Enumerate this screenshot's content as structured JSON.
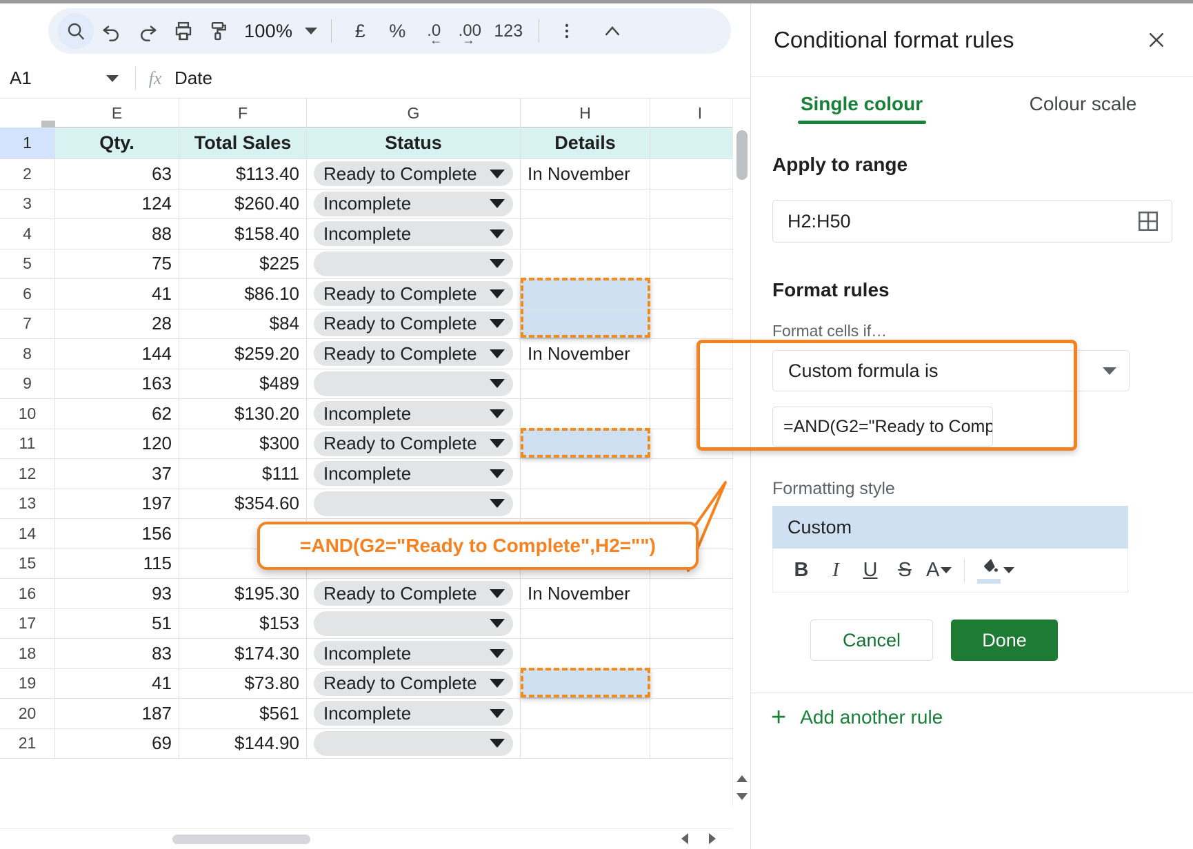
{
  "toolbar": {
    "icons": [
      "search-icon",
      "undo-icon",
      "redo-icon",
      "print-icon",
      "paint-format-icon"
    ],
    "zoom_value": "100%",
    "currency_label": "£",
    "percent_label": "%",
    "decrease_decimal_label": ".0",
    "increase_decimal_label": ".00",
    "more_formats_label": "123",
    "more_icon": "three-dots-vertical-icon",
    "collapse_icon": "chevron-up-icon"
  },
  "formula_bar": {
    "name_box_value": "A1",
    "fx_label": "fx",
    "cell_value": "Date"
  },
  "grid": {
    "columns": [
      "E",
      "F",
      "G",
      "H",
      "I"
    ],
    "header_row": {
      "number": "1",
      "cells": [
        "Qty.",
        "Total Sales",
        "Status",
        "Details",
        ""
      ]
    },
    "rows": [
      {
        "n": "2",
        "qty": "63",
        "sales": "$113.40",
        "status": "Ready to Complete",
        "details": "In November",
        "highlight": false
      },
      {
        "n": "3",
        "qty": "124",
        "sales": "$260.40",
        "status": "Incomplete",
        "details": "",
        "highlight": false
      },
      {
        "n": "4",
        "qty": "88",
        "sales": "$158.40",
        "status": "Incomplete",
        "details": "",
        "highlight": false
      },
      {
        "n": "5",
        "qty": "75",
        "sales": "$225",
        "status": "",
        "details": "",
        "highlight": false
      },
      {
        "n": "6",
        "qty": "41",
        "sales": "$86.10",
        "status": "Ready to Complete",
        "details": "",
        "highlight": true
      },
      {
        "n": "7",
        "qty": "28",
        "sales": "$84",
        "status": "Ready to Complete",
        "details": "",
        "highlight": true
      },
      {
        "n": "8",
        "qty": "144",
        "sales": "$259.20",
        "status": "Ready to Complete",
        "details": "In November",
        "highlight": false
      },
      {
        "n": "9",
        "qty": "163",
        "sales": "$489",
        "status": "",
        "details": "",
        "highlight": false
      },
      {
        "n": "10",
        "qty": "62",
        "sales": "$130.20",
        "status": "Incomplete",
        "details": "",
        "highlight": false
      },
      {
        "n": "11",
        "qty": "120",
        "sales": "$300",
        "status": "Ready to Complete",
        "details": "",
        "highlight": true
      },
      {
        "n": "12",
        "qty": "37",
        "sales": "$111",
        "status": "Incomplete",
        "details": "",
        "highlight": false
      },
      {
        "n": "13",
        "qty": "197",
        "sales": "$354.60",
        "status": "",
        "details": "",
        "highlight": false
      },
      {
        "n": "14",
        "qty": "156",
        "sales": "",
        "status": "",
        "details": "",
        "highlight": false
      },
      {
        "n": "15",
        "qty": "115",
        "sales": "",
        "status": "",
        "details": "",
        "highlight": false
      },
      {
        "n": "16",
        "qty": "93",
        "sales": "$195.30",
        "status": "Ready to Complete",
        "details": "In November",
        "highlight": false
      },
      {
        "n": "17",
        "qty": "51",
        "sales": "$153",
        "status": "",
        "details": "",
        "highlight": false
      },
      {
        "n": "18",
        "qty": "83",
        "sales": "$174.30",
        "status": "Incomplete",
        "details": "",
        "highlight": false
      },
      {
        "n": "19",
        "qty": "41",
        "sales": "$73.80",
        "status": "Ready to Complete",
        "details": "",
        "highlight": true
      },
      {
        "n": "20",
        "qty": "187",
        "sales": "$561",
        "status": "Incomplete",
        "details": "",
        "highlight": false
      },
      {
        "n": "21",
        "qty": "69",
        "sales": "$144.90",
        "status": "",
        "details": "",
        "highlight": false
      }
    ]
  },
  "callout": {
    "text": "=AND(G2=\"Ready to Complete\",H2=\"\")",
    "color": "#f58220"
  },
  "panel": {
    "title": "Conditional format rules",
    "close_icon": "close-icon",
    "tabs": [
      {
        "label": "Single colour",
        "selected": true
      },
      {
        "label": "Colour scale",
        "selected": false
      }
    ],
    "apply_to_range_label": "Apply to range",
    "range_value": "H2:H50",
    "range_picker_icon": "grid-select-icon",
    "format_rules_label": "Format rules",
    "format_cells_if_label": "Format cells if…",
    "condition_value": "Custom formula is",
    "formula_value": "=AND(G2=\"Ready to Comp",
    "formatting_style_label": "Formatting style",
    "preview_text": "Custom",
    "style_buttons": [
      "B",
      "I",
      "U",
      "S",
      "A"
    ],
    "fill_color_icon": "fill-color-icon",
    "fill_color": "#cfe0f3",
    "cancel_label": "Cancel",
    "done_label": "Done",
    "add_rule_label": "Add another rule",
    "add_rule_plus": "+",
    "accent_green": "#188038",
    "highlight_orange": "#f58220"
  }
}
